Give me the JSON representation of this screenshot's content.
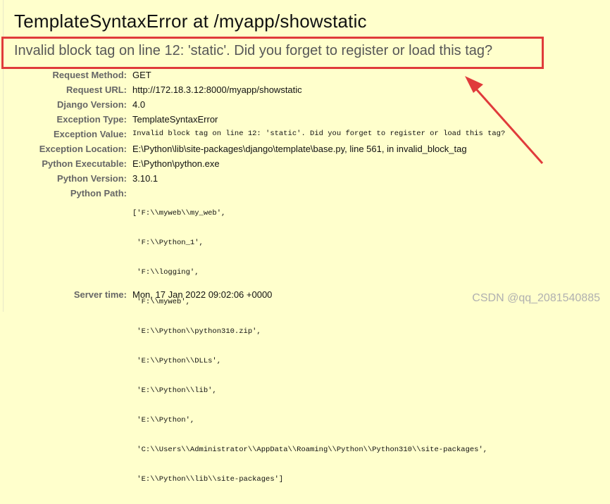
{
  "header": {
    "title": "TemplateSyntaxError at /myapp/showstatic",
    "subtitle": "Invalid block tag on line 12: 'static'. Did you forget to register or load this tag?"
  },
  "meta": [
    {
      "label": "Request Method:",
      "value": "GET"
    },
    {
      "label": "Request URL:",
      "value": "http://172.18.3.12:8000/myapp/showstatic"
    },
    {
      "label": "Django Version:",
      "value": "4.0"
    },
    {
      "label": "Exception Type:",
      "value": "TemplateSyntaxError"
    },
    {
      "label": "Exception Value:",
      "value": "Invalid block tag on line 12: 'static'. Did you forget to register or load this tag?"
    },
    {
      "label": "Exception Location:",
      "value": "E:\\Python\\lib\\site-packages\\django\\template\\base.py, line 561, in invalid_block_tag"
    },
    {
      "label": "Python Executable:",
      "value": "E:\\Python\\python.exe"
    },
    {
      "label": "Python Version:",
      "value": "3.10.1"
    },
    {
      "label": "Python Path:",
      "value": ""
    }
  ],
  "python_path": [
    "['F:\\\\myweb\\\\my_web',",
    " 'F:\\\\Python_1',",
    " 'F:\\\\logging',",
    " 'F:\\\\myweb',",
    " 'E:\\\\Python\\\\python310.zip',",
    " 'E:\\\\Python\\\\DLLs',",
    " 'E:\\\\Python\\\\lib',",
    " 'E:\\\\Python',",
    " 'C:\\\\Users\\\\Administrator\\\\AppData\\\\Roaming\\\\Python\\\\Python310\\\\site-packages',",
    " 'E:\\\\Python\\\\lib\\\\site-packages']"
  ],
  "server_time": {
    "label": "Server time:",
    "value": "Mon, 17 Jan 2022 09:02:06 +0000"
  },
  "watermark": "CSDN @qq_2081540885",
  "colors": {
    "background": "#ffffcc",
    "highlight": "#e03b3b"
  }
}
